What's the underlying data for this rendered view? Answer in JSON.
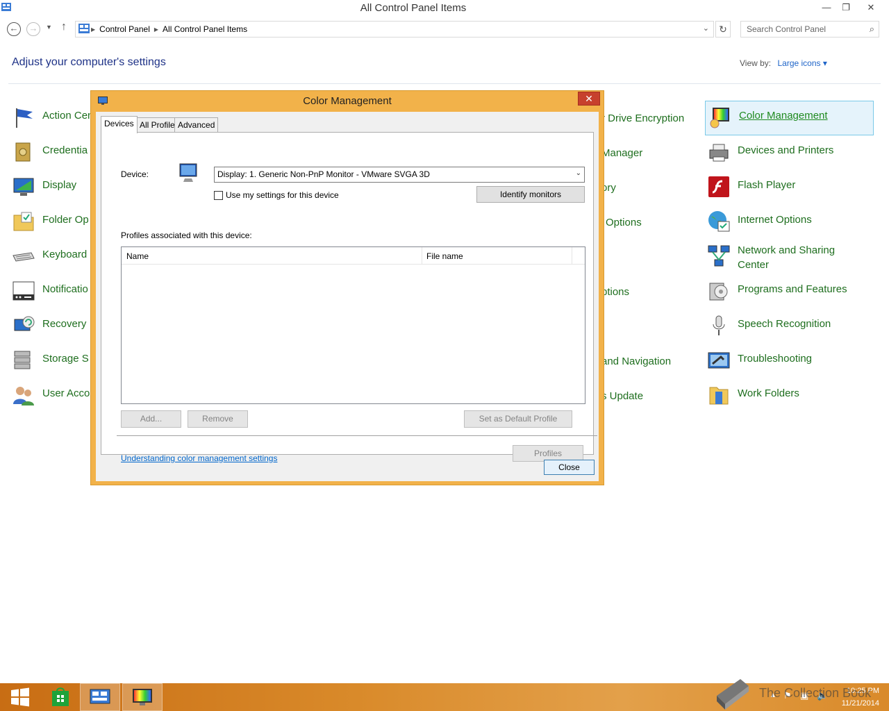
{
  "window": {
    "title": "All Control Panel Items",
    "minimize": "—",
    "restore": "❐",
    "close": "✕"
  },
  "address": {
    "crumbs": [
      "Control Panel",
      "All Control Panel Items"
    ],
    "search_placeholder": "Search Control Panel"
  },
  "header": {
    "heading": "Adjust your computer's settings",
    "view_by_label": "View by:",
    "view_by_value": "Large icons ▾"
  },
  "items": {
    "left": [
      "Action Cen",
      "Credentia",
      "Display",
      "Folder Op",
      "Keyboard",
      "Notificatio",
      "Recovery",
      "Storage S",
      "User Acco"
    ],
    "middle": [
      "r Drive Encryption",
      "Manager",
      "ory",
      "Options",
      "",
      "ptions",
      "",
      "and Navigation",
      "s Update"
    ],
    "right": [
      "Color Management",
      "Devices and Printers",
      "Flash Player",
      "Internet Options",
      "Network and Sharing Center",
      "Programs and Features",
      "Speech Recognition",
      "Troubleshooting",
      "Work Folders"
    ]
  },
  "dialog": {
    "title": "Color Management",
    "close_x": "✕",
    "tabs": [
      "Devices",
      "All Profiles",
      "Advanced"
    ],
    "device_label": "Device:",
    "device_value": "Display: 1. Generic Non-PnP Monitor - VMware SVGA 3D",
    "use_my_settings": "Use my settings for this device",
    "identify_monitors": "Identify monitors",
    "profiles_label": "Profiles associated with this device:",
    "columns": [
      "Name",
      "File name"
    ],
    "add": "Add...",
    "remove": "Remove",
    "set_default": "Set as Default Profile",
    "help_link": "Understanding color management settings",
    "profiles_btn": "Profiles",
    "close_btn": "Close"
  },
  "taskbar": {
    "time": "10:25 PM",
    "date": "11/21/2014"
  },
  "watermark": "The Collection Book",
  "colors": {
    "accent": "#f2b24a",
    "link_green": "#1e6e1e",
    "heading_blue": "#1e3287"
  }
}
